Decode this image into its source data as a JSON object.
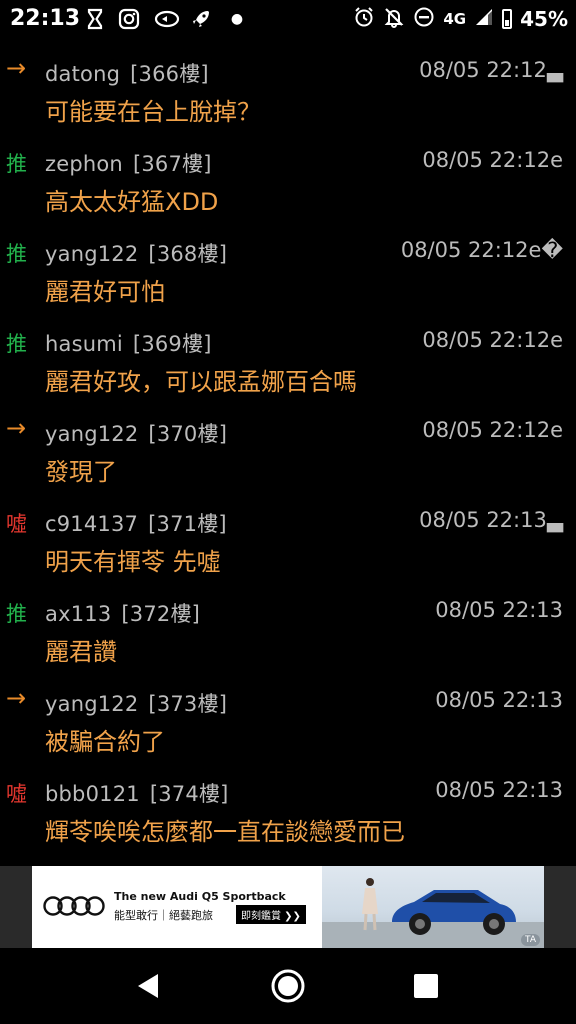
{
  "status_bar": {
    "time": "22:13",
    "left_icons": [
      "hourglass-icon",
      "instagram-icon",
      "fidget-spinner-icon",
      "rocket-icon",
      "dot-icon"
    ],
    "right_icons": [
      "alarm-icon",
      "bell-off-icon",
      "do-not-disturb-icon"
    ],
    "network": "4G",
    "battery": "45%"
  },
  "colors": {
    "push": "#22b14c",
    "arrow": "#e98b2a",
    "boo": "#e5372f",
    "message": "#f0a24a",
    "meta": "#bcbcbc",
    "background": "#000000"
  },
  "comments": [
    {
      "tag": "→",
      "type": "arrow",
      "user": "datong",
      "floor": "[366樓]",
      "time": "08/05 22:12",
      "suffix": "▃",
      "text": "可能要在台上脫掉？"
    },
    {
      "tag": "推",
      "type": "push",
      "user": "zephon",
      "floor": "[367樓]",
      "time": "08/05 22:12",
      "suffix": "e",
      "text": "高太太好猛XDD"
    },
    {
      "tag": "推",
      "type": "push",
      "user": "yang122",
      "floor": "[368樓]",
      "time": "08/05 22:12",
      "suffix": "e�",
      "text": "麗君好可怕"
    },
    {
      "tag": "推",
      "type": "push",
      "user": "hasumi",
      "floor": "[369樓]",
      "time": "08/05 22:12",
      "suffix": "e",
      "text": "麗君好攻，可以跟孟娜百合嗎"
    },
    {
      "tag": "→",
      "type": "arrow",
      "user": "yang122",
      "floor": "[370樓]",
      "time": "08/05 22:12",
      "suffix": "e",
      "text": "發現了"
    },
    {
      "tag": "噓",
      "type": "boo",
      "user": "c914137",
      "floor": "[371樓]",
      "time": "08/05 22:13",
      "suffix": "▃",
      "text": "明天有揮苓  先噓"
    },
    {
      "tag": "推",
      "type": "push",
      "user": "ax113",
      "floor": "[372樓]",
      "time": "08/05 22:13",
      "suffix": "",
      "text": "麗君讚"
    },
    {
      "tag": "→",
      "type": "arrow",
      "user": "yang122",
      "floor": "[373樓]",
      "time": "08/05 22:13",
      "suffix": "",
      "text": "被騙合約了"
    },
    {
      "tag": "噓",
      "type": "boo",
      "user": "bbb0121",
      "floor": "[374樓]",
      "time": "08/05 22:13",
      "suffix": "",
      "text": "輝苓唉唉怎麼都一直在談戀愛而已"
    }
  ],
  "ad": {
    "title": "The new Audi Q5 Sportback",
    "subtitle": "能型敢行｜絕藝跑旅",
    "cta": "即刻鑑賞 ❯❯",
    "badge": "TA"
  },
  "nav_bar": {
    "icons": [
      "back-icon",
      "home-icon",
      "recents-icon"
    ]
  }
}
